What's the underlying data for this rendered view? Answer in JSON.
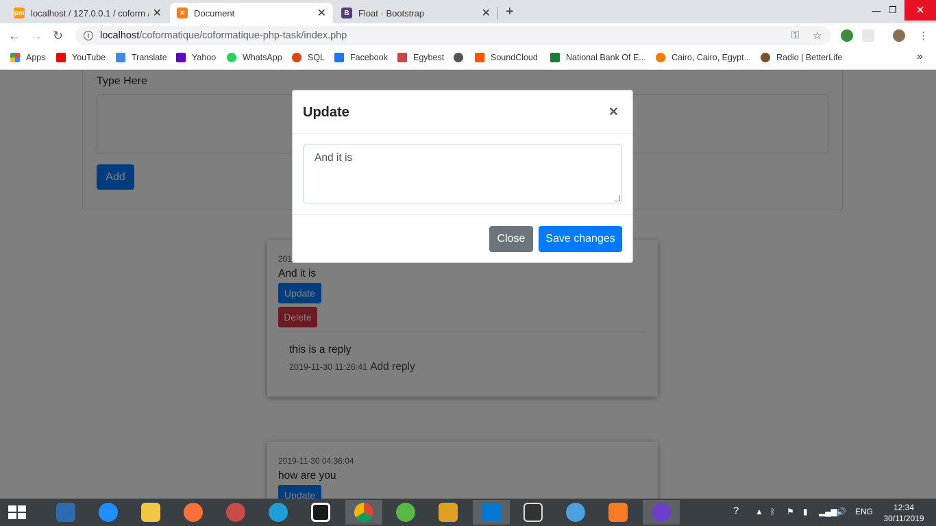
{
  "browser": {
    "tabs": [
      {
        "title": "localhost / 127.0.0.1 / coform / re",
        "icon": "phpmyadmin-icon",
        "active": false
      },
      {
        "title": "Document",
        "icon": "xampp-icon",
        "active": true
      },
      {
        "title": "Float · Bootstrap",
        "icon": "bootstrap-icon",
        "active": false
      }
    ],
    "new_tab": "+",
    "window_controls": {
      "minimize": "—",
      "restore": "❐",
      "close": "✕"
    },
    "url_host": "localhost",
    "url_path": "/coformatique/coformatique-php-task/index.php"
  },
  "bookmarks": [
    {
      "label": "Apps",
      "icon": "apps-icon",
      "color": "#e8453c"
    },
    {
      "label": "YouTube",
      "icon": "youtube-icon",
      "color": "#ff0000"
    },
    {
      "label": "Translate",
      "icon": "translate-icon",
      "color": "#4285f4"
    },
    {
      "label": "Yahoo",
      "icon": "yahoo-icon",
      "color": "#6001d2"
    },
    {
      "label": "WhatsApp",
      "icon": "whatsapp-icon",
      "color": "#25d366"
    },
    {
      "label": "SQL",
      "icon": "sql-icon",
      "color": "#d9480f"
    },
    {
      "label": "Facebook",
      "icon": "facebook-icon",
      "color": "#1877f2"
    },
    {
      "label": "Egybest",
      "icon": "egybest-icon",
      "color": "#cc4444"
    },
    {
      "label": "",
      "icon": "globe-icon",
      "color": "#555555"
    },
    {
      "label": "SoundCloud",
      "icon": "soundcloud-icon",
      "color": "#ff5500"
    },
    {
      "label": "National Bank Of E...",
      "icon": "bank-icon",
      "color": "#1d7a3a"
    },
    {
      "label": "Cairo, Cairo, Egypt...",
      "icon": "weather-icon",
      "color": "#f57c00"
    },
    {
      "label": "Radio | BetterLife",
      "icon": "radio-icon",
      "color": "#7a5230"
    }
  ],
  "bookmarks_more": "»",
  "form": {
    "label": "Type Here",
    "add_button": "Add"
  },
  "comments": [
    {
      "date": "2019-11-30 04:36:04",
      "date_visible": "201",
      "text": "And it is",
      "update_label": "Update",
      "delete_label": "Delete",
      "reply": {
        "text": "this is a reply",
        "date": "2019-11-30 11:26:41",
        "add_reply": "Add reply"
      }
    },
    {
      "date": "2019-11-30 04:36:04",
      "text": "how are you",
      "update_label": "Update"
    }
  ],
  "modal": {
    "title": "Update",
    "close_x": "×",
    "textarea_value": "And it is",
    "close_button": "Close",
    "save_button": "Save changes"
  },
  "taskbar": {
    "apps": [
      "network-icon",
      "internet-explorer-icon",
      "file-explorer-icon",
      "firefox-icon",
      "snipping-icon",
      "edge-icon",
      "frame-icon",
      "chrome-icon",
      "utorrent-icon",
      "nodejs-icon",
      "vscode-icon",
      "media-player-icon",
      "teams-icon",
      "xampp-icon",
      "github-desktop-icon"
    ],
    "language": "ENG",
    "time": "12:34",
    "date": "30/11/2019"
  },
  "colors": {
    "primary": "#007bff",
    "danger": "#dc3545",
    "secondary": "#6c757d",
    "chrome_close": "#e81123"
  }
}
